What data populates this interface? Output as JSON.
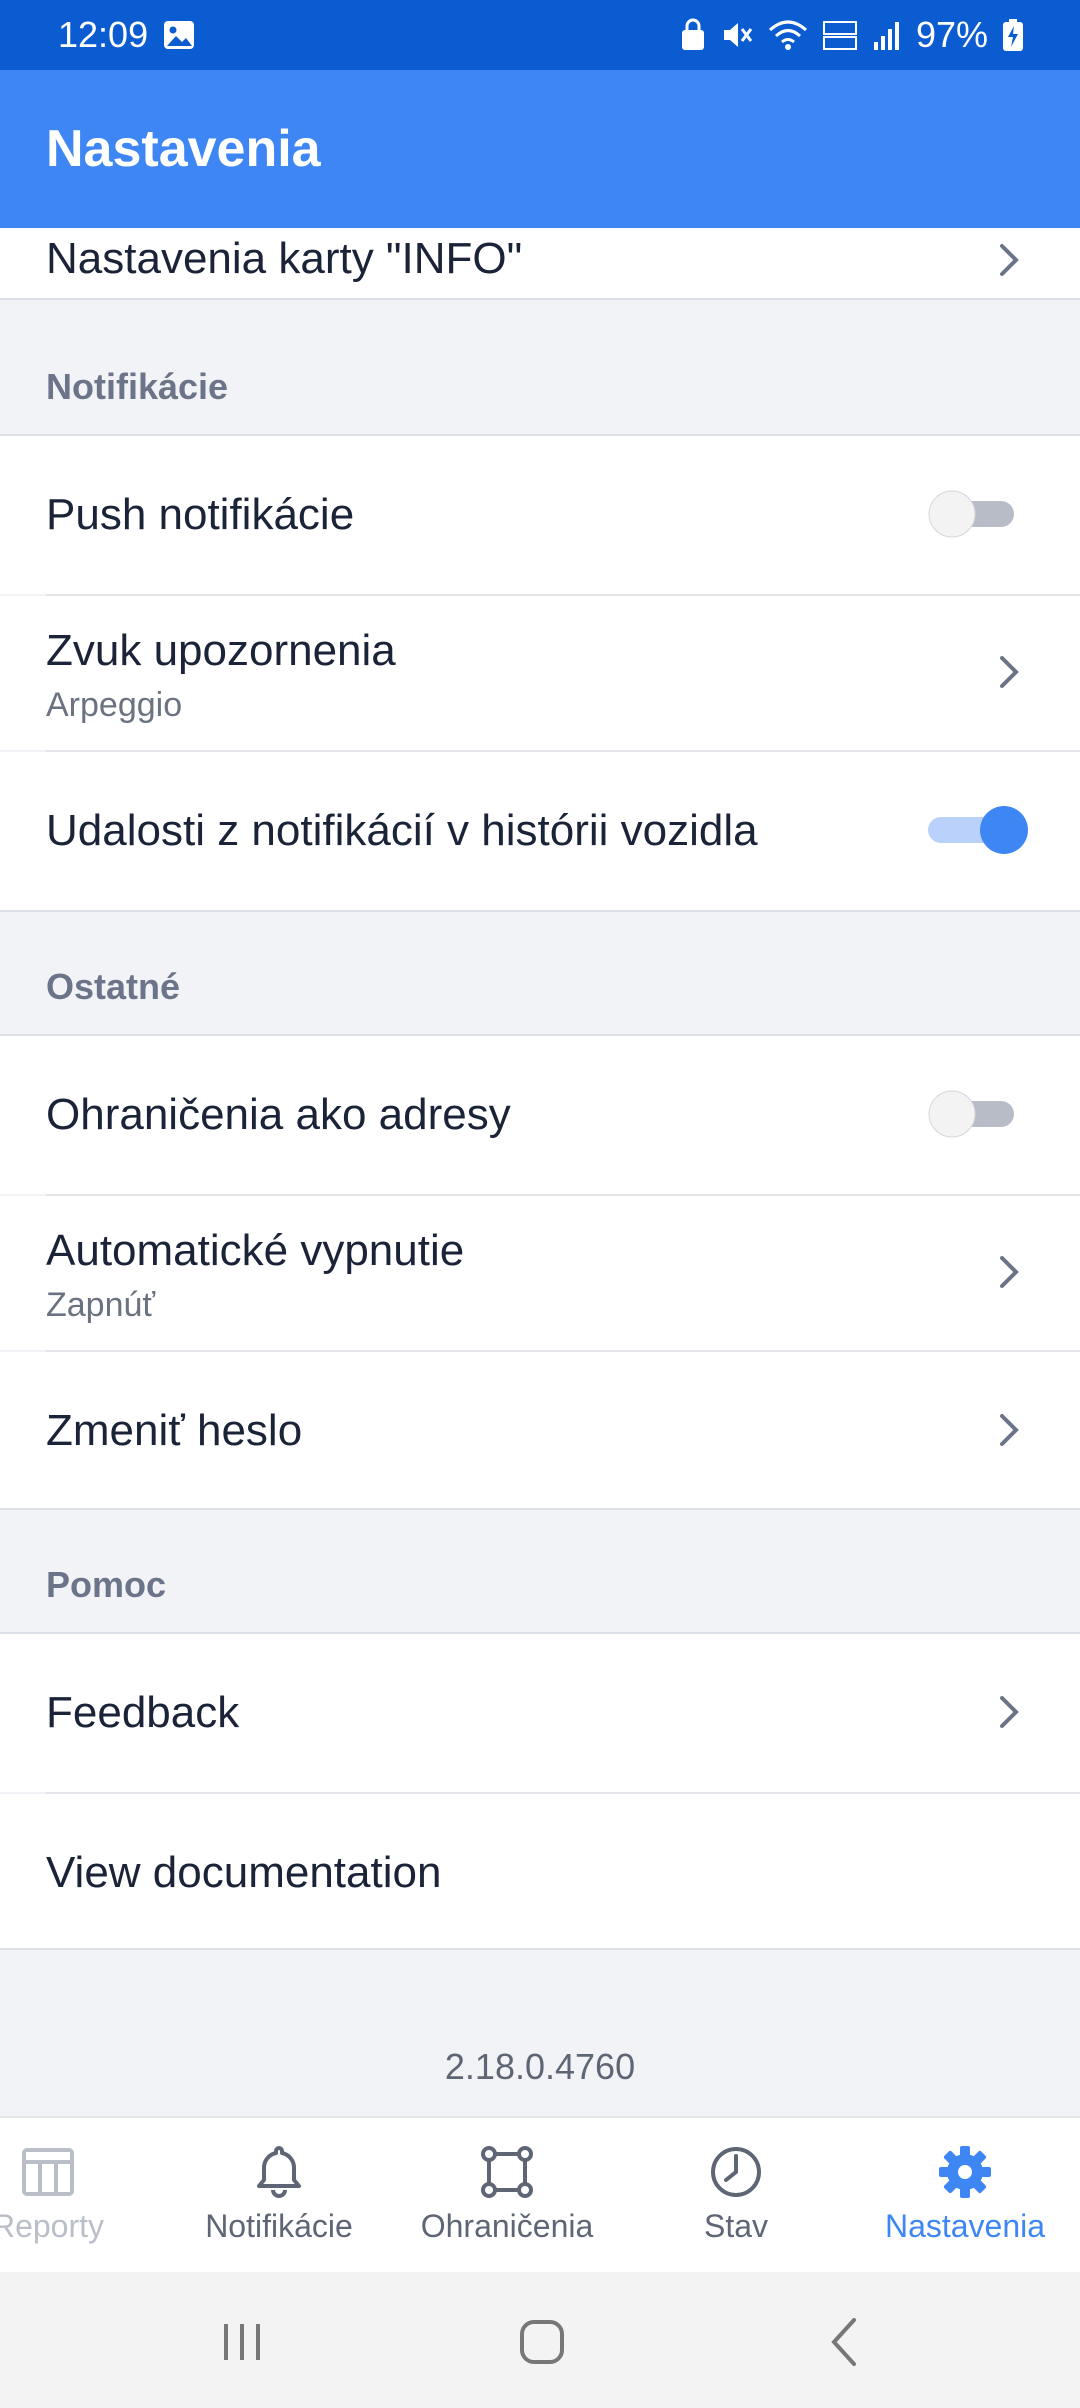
{
  "status_bar": {
    "time": "12:09",
    "battery": "97%"
  },
  "app_bar": {
    "title": "Nastavenia"
  },
  "top_partial_item": {
    "label": "Nastavenia karty \"INFO\""
  },
  "sections": {
    "notifications": {
      "header": "Notifikácie",
      "push": {
        "label": "Push notifikácie",
        "enabled": false
      },
      "sound": {
        "label": "Zvuk upozornenia",
        "value": "Arpeggio"
      },
      "history": {
        "label": "Udalosti z notifikácií v histórii vozidla",
        "enabled": true
      }
    },
    "other": {
      "header": "Ostatné",
      "geofence_addresses": {
        "label": "Ohraničenia ako adresy",
        "enabled": false
      },
      "auto_off": {
        "label": "Automatické vypnutie",
        "value": "Zapnúť"
      },
      "change_password": {
        "label": "Zmeniť heslo"
      }
    },
    "help": {
      "header": "Pomoc",
      "feedback": {
        "label": "Feedback"
      },
      "documentation": {
        "label": "View documentation"
      }
    }
  },
  "version": "2.18.0.4760",
  "bottom_nav": {
    "reports": "Reporty",
    "notifications": "Notifikácie",
    "geofences": "Ohraničenia",
    "status": "Stav",
    "settings": "Nastavenia",
    "active": "settings"
  },
  "colors": {
    "accent": "#3f86f5",
    "status_bar": "#0b5cd0",
    "background": "#f2f3f6"
  }
}
